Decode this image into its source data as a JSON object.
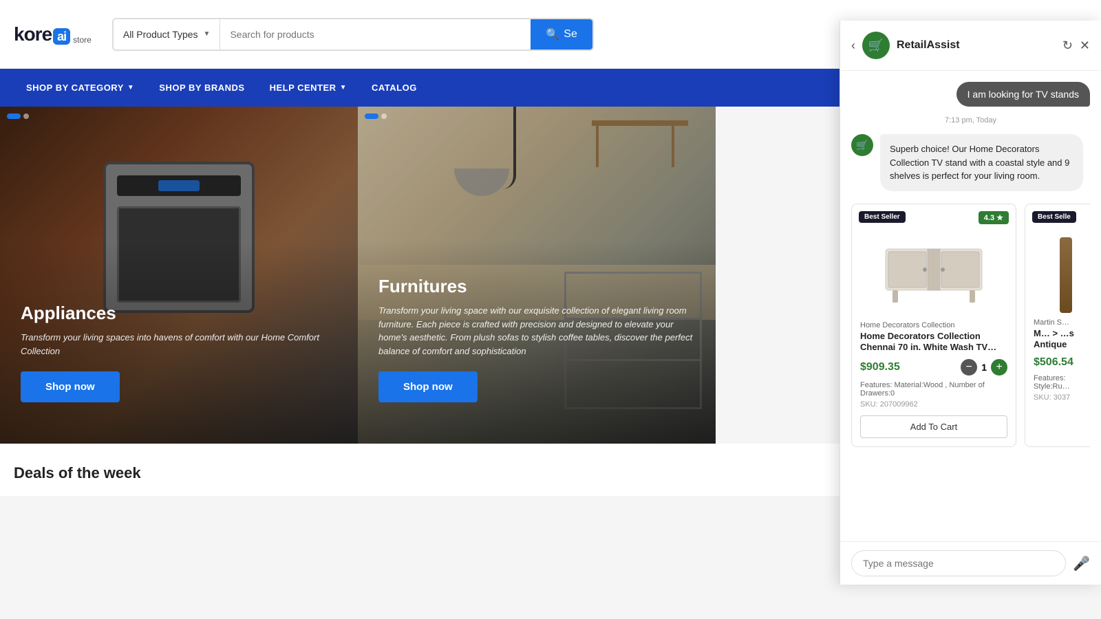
{
  "header": {
    "logo_name": "kore",
    "logo_ai": "ai",
    "logo_store": "store",
    "search_placeholder": "Search for products",
    "search_dropdown_label": "All Product Types",
    "search_btn_label": "Se"
  },
  "nav": {
    "items": [
      {
        "label": "SHOP BY CATEGORY",
        "has_arrow": true
      },
      {
        "label": "SHOP BY BRANDS",
        "has_arrow": false
      },
      {
        "label": "HELP CENTER",
        "has_arrow": true
      },
      {
        "label": "CATALOG",
        "has_arrow": false
      }
    ]
  },
  "banner": {
    "cards": [
      {
        "title": "Appliances",
        "description": "Transform your living spaces into havens of comfort with our Home Comfort Collection",
        "shop_now": "Shop now"
      },
      {
        "title": "Furnitures",
        "description": "Transform your living space with our exquisite collection of elegant living room furniture. Each piece is crafted with precision and designed to elevate your home's aesthetic. From plush sofas to stylish coffee tables, discover the perfect balance of comfort and sophistication",
        "shop_now": "Shop now"
      }
    ]
  },
  "deals": {
    "title": "Deals of the week"
  },
  "chat": {
    "bot_name": "RetailAssist",
    "user_message": "I am looking for TV stands",
    "timestamp": "7:13 pm, Today",
    "bot_response": "Superb choice! Our Home Decorators Collection TV stand with a coastal style and 9 shelves is perfect for your living room.",
    "input_placeholder": "Type a message",
    "products": [
      {
        "badge": "Best Seller",
        "rating": "4.3 ★",
        "brand": "Home Decorators Collection",
        "title": "Home Decorators Collection Chennai 70 in. White Wash TV…",
        "price": "$909.35",
        "qty": "1",
        "features": "Features: Material:Wood , Number of Drawers:0",
        "sku": "SKU: 207009962",
        "add_to_cart": "Add To Cart"
      },
      {
        "badge": "Best Selle",
        "brand": "Martin S…",
        "title": "M… > …s Antique",
        "price": "$506.54",
        "features": "Features: Style:Ru…",
        "sku": "SKU: 3037"
      }
    ]
  }
}
